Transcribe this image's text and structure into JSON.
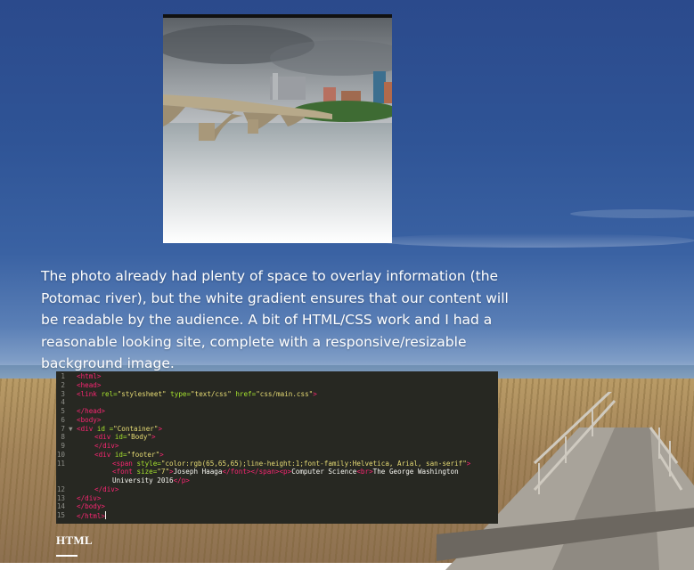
{
  "caption": {
    "text": "The photo already had plenty of space to overlay information (the Potomac river), but the white gradient ensures that our content will be readable by the audience. A bit of HTML/CSS work and I had a reasonable looking site, complete with a responsive/resizable background image."
  },
  "code_editor": {
    "lines": [
      {
        "n": "1",
        "fold": "",
        "indent": 0,
        "parts": [
          [
            "tag",
            "<html>"
          ]
        ]
      },
      {
        "n": "2",
        "fold": "",
        "indent": 0,
        "parts": [
          [
            "tag",
            "<head>"
          ]
        ]
      },
      {
        "n": "3",
        "fold": "",
        "indent": 0,
        "parts": [
          [
            "tag",
            "<link "
          ],
          [
            "att",
            "rel="
          ],
          [
            "str",
            "\"stylesheet\""
          ],
          [
            "att",
            " type="
          ],
          [
            "str",
            "\"text/css\""
          ],
          [
            "att",
            " href="
          ],
          [
            "str",
            "\"css/main.css\""
          ],
          [
            "tag",
            ">"
          ]
        ]
      },
      {
        "n": "4",
        "fold": "",
        "indent": 0,
        "parts": []
      },
      {
        "n": "5",
        "fold": "",
        "indent": 0,
        "parts": [
          [
            "tag",
            "</head>"
          ]
        ]
      },
      {
        "n": "6",
        "fold": "",
        "indent": 0,
        "parts": [
          [
            "tag",
            "<body>"
          ]
        ]
      },
      {
        "n": "7",
        "fold": "▼",
        "indent": 0,
        "parts": [
          [
            "tag",
            "<div "
          ],
          [
            "att",
            "id ="
          ],
          [
            "str",
            "\"Container\""
          ],
          [
            "tag",
            ">"
          ]
        ]
      },
      {
        "n": "8",
        "fold": "",
        "indent": 1,
        "parts": [
          [
            "tag",
            "<div "
          ],
          [
            "att",
            "id="
          ],
          [
            "str",
            "\"Body\""
          ],
          [
            "tag",
            ">"
          ]
        ]
      },
      {
        "n": "9",
        "fold": "",
        "indent": 1,
        "parts": [
          [
            "tag",
            "</div>"
          ]
        ]
      },
      {
        "n": "10",
        "fold": "",
        "indent": 1,
        "parts": [
          [
            "tag",
            "<div "
          ],
          [
            "att",
            "id="
          ],
          [
            "str",
            "\"footer\""
          ],
          [
            "tag",
            ">"
          ]
        ]
      },
      {
        "n": "11",
        "fold": "",
        "indent": 2,
        "parts": [
          [
            "tag",
            "<span "
          ],
          [
            "att",
            "style="
          ],
          [
            "str",
            "\"color:rgb(65,65,65);line-height:1;font-family:Helvetica, Arial, san-serif\""
          ],
          [
            "tag",
            ">"
          ]
        ]
      },
      {
        "n": "",
        "fold": "",
        "indent": 2,
        "parts": [
          [
            "tag",
            "<font "
          ],
          [
            "att",
            "size="
          ],
          [
            "str",
            "\"7\""
          ],
          [
            "tag",
            ">"
          ],
          [
            "txt",
            "Joseph Haaga"
          ],
          [
            "tag",
            "</font></span><p>"
          ],
          [
            "txt",
            "Computer Science"
          ],
          [
            "tag",
            "<br>"
          ],
          [
            "txt",
            "The George Washington"
          ]
        ]
      },
      {
        "n": "",
        "fold": "",
        "indent": 2,
        "parts": [
          [
            "txt",
            "University 2016"
          ],
          [
            "tag",
            "</p>"
          ]
        ]
      },
      {
        "n": "12",
        "fold": "",
        "indent": 1,
        "parts": [
          [
            "tag",
            "</div>"
          ]
        ]
      },
      {
        "n": "13",
        "fold": "",
        "indent": 0,
        "parts": [
          [
            "tag",
            "</div>"
          ]
        ]
      },
      {
        "n": "14",
        "fold": "",
        "indent": 0,
        "parts": [
          [
            "tag",
            "</body>"
          ]
        ]
      },
      {
        "n": "15",
        "fold": "",
        "indent": 0,
        "parts": [
          [
            "tag",
            "</html>"
          ]
        ],
        "cursor": true
      }
    ]
  },
  "section": {
    "label": "HTML"
  },
  "colors": {
    "code_bg": "#272822",
    "tag": "#f92672",
    "attribute": "#a6e22e",
    "string": "#e6db74"
  }
}
